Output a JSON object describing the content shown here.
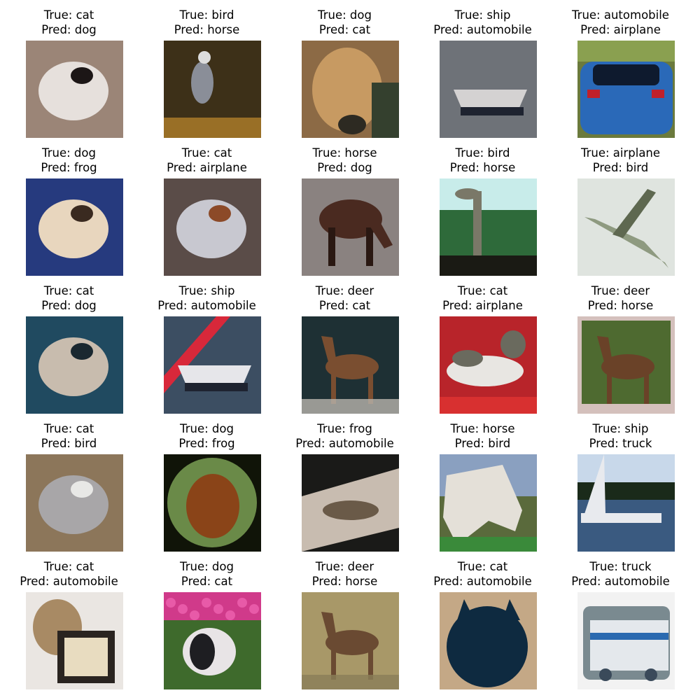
{
  "samples": [
    {
      "true_label": "True: cat",
      "pred_label": "Pred: dog",
      "bg": "#9b8577",
      "fg": "#e6e0dc",
      "accent": "#1c1616",
      "shape": "blob"
    },
    {
      "true_label": "True: bird",
      "pred_label": "Pred: horse",
      "bg": "#3d3018",
      "fg": "#8a8e98",
      "accent": "#c08a2c",
      "shape": "bird"
    },
    {
      "true_label": "True: dog",
      "pred_label": "Pred: cat",
      "bg": "#8c6a45",
      "fg": "#c79a62",
      "accent": "#2d2a22",
      "shape": "dogface"
    },
    {
      "true_label": "True: ship",
      "pred_label": "Pred: automobile",
      "bg": "#6e7278",
      "fg": "#d4d2d2",
      "accent": "#3e5a66",
      "shape": "boat"
    },
    {
      "true_label": "True: automobile",
      "pred_label": "Pred: airplane",
      "bg": "#6b7a3c",
      "fg": "#2a69b8",
      "accent": "#0e1a2e",
      "shape": "car"
    },
    {
      "true_label": "True: dog",
      "pred_label": "Pred: frog",
      "bg": "#263a7e",
      "fg": "#e8d6be",
      "accent": "#3a2a20",
      "shape": "blob"
    },
    {
      "true_label": "True: cat",
      "pred_label": "Pred: airplane",
      "bg": "#5a4c48",
      "fg": "#c8c8d0",
      "accent": "#8c4a28",
      "shape": "blob"
    },
    {
      "true_label": "True: horse",
      "pred_label": "Pred: dog",
      "bg": "#8a8280",
      "fg": "#4a2a20",
      "accent": "#2a1812",
      "shape": "horse"
    },
    {
      "true_label": "True: bird",
      "pred_label": "Pred: horse",
      "bg": "#2e6a3a",
      "fg": "#7a7868",
      "accent": "#c8ecea",
      "shape": "ostrich"
    },
    {
      "true_label": "True: airplane",
      "pred_label": "Pred: bird",
      "bg": "#dfe4df",
      "fg": "#8e9a80",
      "accent": "#5e6850",
      "shape": "plane"
    },
    {
      "true_label": "True: cat",
      "pred_label": "Pred: dog",
      "bg": "#204a60",
      "fg": "#c8bcae",
      "accent": "#1a2830",
      "shape": "blob"
    },
    {
      "true_label": "True: ship",
      "pred_label": "Pred: automobile",
      "bg": "#3c4e62",
      "fg": "#e6e6ea",
      "accent": "#d8283a",
      "shape": "boat2"
    },
    {
      "true_label": "True: deer",
      "pred_label": "Pred: cat",
      "bg": "#1e3034",
      "fg": "#7a4e30",
      "accent": "#b8b4ac",
      "shape": "deer"
    },
    {
      "true_label": "True: cat",
      "pred_label": "Pred: airplane",
      "bg": "#b8242a",
      "fg": "#e8e6e2",
      "accent": "#6a6a5e",
      "shape": "lyingcat"
    },
    {
      "true_label": "True: deer",
      "pred_label": "Pred: horse",
      "bg": "#4e6a30",
      "fg": "#6a4228",
      "accent": "#d4c0bc",
      "shape": "deer2"
    },
    {
      "true_label": "True: cat",
      "pred_label": "Pred: bird",
      "bg": "#8c765a",
      "fg": "#a8a6a8",
      "accent": "#e8e8e6",
      "shape": "blob"
    },
    {
      "true_label": "True: dog",
      "pred_label": "Pred: frog",
      "bg": "#6a8a48",
      "fg": "#8a4418",
      "accent": "#101408",
      "shape": "circle"
    },
    {
      "true_label": "True: frog",
      "pred_label": "Pred: automobile",
      "bg": "#1a1a18",
      "fg": "#c8bcb0",
      "accent": "#6a5a48",
      "shape": "frog"
    },
    {
      "true_label": "True: horse",
      "pred_label": "Pred: bird",
      "bg": "#5a6a3c",
      "fg": "#e4e0d8",
      "accent": "#8aa0c0",
      "shape": "horsehead"
    },
    {
      "true_label": "True: ship",
      "pred_label": "Pred: truck",
      "bg": "#3a5a80",
      "fg": "#e8eaee",
      "accent": "#c8d8ea",
      "shape": "sail"
    },
    {
      "true_label": "True: cat",
      "pred_label": "Pred: automobile",
      "bg": "#eae6e2",
      "fg": "#a88a64",
      "accent": "#2a2420",
      "shape": "catframe"
    },
    {
      "true_label": "True: dog",
      "pred_label": "Pred: cat",
      "bg": "#3e6a2c",
      "fg": "#e8e4e6",
      "accent": "#d03a8a",
      "shape": "flowers"
    },
    {
      "true_label": "True: deer",
      "pred_label": "Pred: horse",
      "bg": "#a89868",
      "fg": "#6a4a32",
      "accent": "#8a7e58",
      "shape": "deer3"
    },
    {
      "true_label": "True: cat",
      "pred_label": "Pred: automobile",
      "bg": "#c4a886",
      "fg": "#0e2a40",
      "accent": "#1a4058",
      "shape": "darkcat"
    },
    {
      "true_label": "True: truck",
      "pred_label": "Pred: automobile",
      "bg": "#f2f2f2",
      "fg": "#e4e8ec",
      "accent": "#3a4a5a",
      "shape": "truck"
    }
  ]
}
